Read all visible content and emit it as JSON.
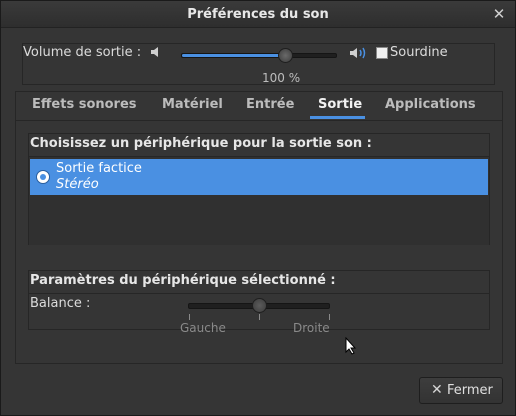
{
  "window": {
    "title": "Préférences du son",
    "close_glyph": "✕"
  },
  "output_volume": {
    "label": "Volume de sortie :",
    "value_percent": 100,
    "value_text": "100 %",
    "mute_label": "Sourdine",
    "mute_checked": false,
    "icons": [
      "speaker-low-icon",
      "speaker-high-icon"
    ]
  },
  "tabs": [
    {
      "label": "Effets sonores",
      "active": false
    },
    {
      "label": "Matériel",
      "active": false
    },
    {
      "label": "Entrée",
      "active": false
    },
    {
      "label": "Sortie",
      "active": true
    },
    {
      "label": "Applications",
      "active": false
    }
  ],
  "device_section": {
    "title": "Choisissez un périphérique pour la sortie son :",
    "devices": [
      {
        "name": "Sortie factice",
        "profile": "Stéréo",
        "selected": true
      }
    ]
  },
  "device_settings": {
    "title": "Paramètres du périphérique sélectionné :",
    "balance_label": "Balance :",
    "balance_value": 0.5,
    "left_label": "Gauche",
    "right_label": "Droite"
  },
  "footer": {
    "close_label": "Fermer",
    "close_icon": "close-icon"
  },
  "colors": {
    "accent": "#4a90e2",
    "background": "#353535",
    "text": "#dcdcdc"
  }
}
